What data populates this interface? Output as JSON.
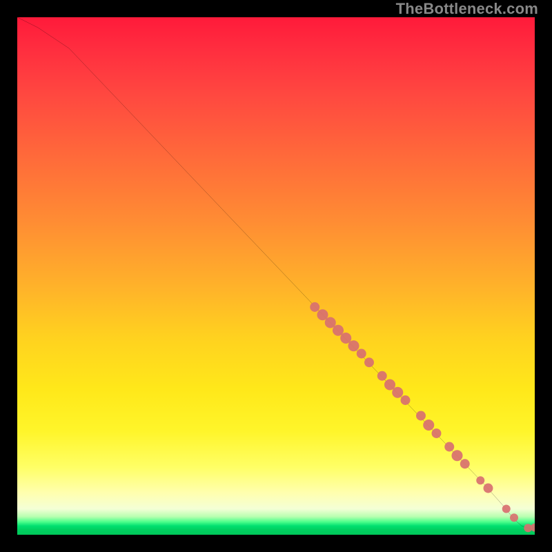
{
  "watermark": "TheBottleneck.com",
  "chart_data": {
    "type": "line",
    "title": "",
    "xlabel": "",
    "ylabel": "",
    "xlim": [
      0,
      100
    ],
    "ylim": [
      0,
      100
    ],
    "grid": false,
    "legend": false,
    "series": [
      {
        "name": "bottleneck-curve",
        "x": [
          0,
          4,
          10,
          20,
          30,
          40,
          50,
          60,
          70,
          80,
          90,
          94,
          96,
          97.5,
          99,
          100
        ],
        "y": [
          100,
          98,
          94,
          83.5,
          73,
          62.5,
          52,
          41.5,
          31,
          20.5,
          10,
          5.5,
          3,
          1.7,
          1.2,
          1.4
        ],
        "color": "#000000",
        "linewidth": 1.4
      }
    ],
    "markers": [
      {
        "name": "highlight-points",
        "color": "#d87070",
        "radius_range": [
          5,
          9
        ],
        "points": [
          {
            "x": 57.5,
            "y": 44.0,
            "r": 7
          },
          {
            "x": 59.0,
            "y": 42.5,
            "r": 8
          },
          {
            "x": 60.5,
            "y": 41.0,
            "r": 8
          },
          {
            "x": 62.0,
            "y": 39.5,
            "r": 8
          },
          {
            "x": 63.5,
            "y": 38.0,
            "r": 8
          },
          {
            "x": 65.0,
            "y": 36.5,
            "r": 8
          },
          {
            "x": 66.5,
            "y": 35.0,
            "r": 7
          },
          {
            "x": 68.0,
            "y": 33.3,
            "r": 7
          },
          {
            "x": 70.5,
            "y": 30.7,
            "r": 7
          },
          {
            "x": 72.0,
            "y": 29.0,
            "r": 8
          },
          {
            "x": 73.5,
            "y": 27.5,
            "r": 8
          },
          {
            "x": 75.0,
            "y": 26.0,
            "r": 7
          },
          {
            "x": 78.0,
            "y": 23.0,
            "r": 7
          },
          {
            "x": 79.5,
            "y": 21.2,
            "r": 8
          },
          {
            "x": 81.0,
            "y": 19.6,
            "r": 7
          },
          {
            "x": 83.5,
            "y": 17.0,
            "r": 7
          },
          {
            "x": 85.0,
            "y": 15.3,
            "r": 8
          },
          {
            "x": 86.5,
            "y": 13.7,
            "r": 7
          },
          {
            "x": 89.5,
            "y": 10.5,
            "r": 6
          },
          {
            "x": 91.0,
            "y": 9.0,
            "r": 7
          },
          {
            "x": 94.5,
            "y": 5.0,
            "r": 6
          },
          {
            "x": 96.0,
            "y": 3.3,
            "r": 6
          },
          {
            "x": 98.7,
            "y": 1.3,
            "r": 6
          },
          {
            "x": 100.0,
            "y": 1.4,
            "r": 6
          }
        ]
      }
    ]
  }
}
